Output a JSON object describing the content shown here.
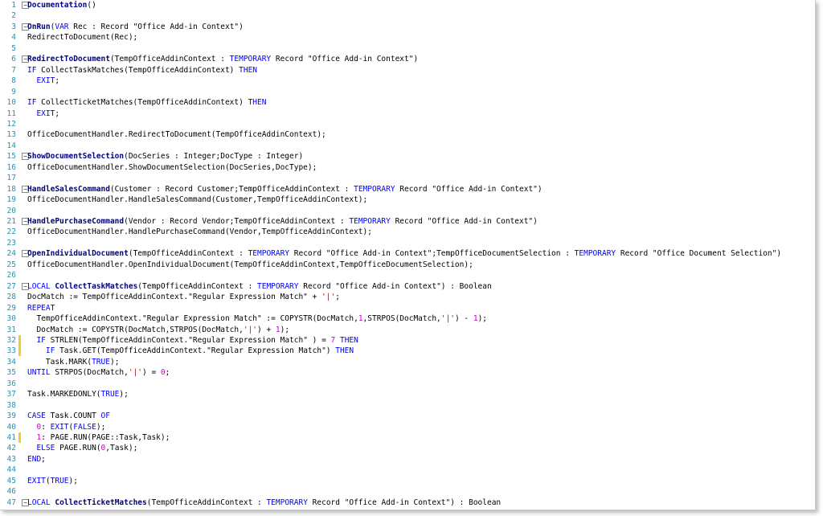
{
  "editor": {
    "lines": [
      {
        "n": "1",
        "fold": true,
        "t": [
          {
            "c": "fn",
            "v": "Documentation"
          },
          {
            "c": "pun",
            "v": "()"
          }
        ]
      },
      {
        "n": "2",
        "t": []
      },
      {
        "n": "3",
        "fold": true,
        "t": [
          {
            "c": "fn",
            "v": "OnRun"
          },
          {
            "c": "pun",
            "v": "("
          },
          {
            "c": "kw",
            "v": "VAR"
          },
          {
            "c": "pun",
            "v": " Rec : Record \"Office Add-in Context\")"
          }
        ]
      },
      {
        "n": "4",
        "t": [
          {
            "c": "pun",
            "v": "RedirectToDocument(Rec);"
          }
        ]
      },
      {
        "n": "5",
        "t": []
      },
      {
        "n": "6",
        "fold": true,
        "t": [
          {
            "c": "fn",
            "v": "RedirectToDocument"
          },
          {
            "c": "pun",
            "v": "(TempOfficeAddinContext : "
          },
          {
            "c": "kw",
            "v": "TEMPORARY"
          },
          {
            "c": "pun",
            "v": " Record \"Office Add-in Context\")"
          }
        ]
      },
      {
        "n": "7",
        "t": [
          {
            "c": "kw",
            "v": "IF"
          },
          {
            "c": "pun",
            "v": " CollectTaskMatches(TempOfficeAddinContext) "
          },
          {
            "c": "kw",
            "v": "THEN"
          }
        ]
      },
      {
        "n": "8",
        "t": [
          {
            "c": "pun",
            "v": "  "
          },
          {
            "c": "kw",
            "v": "EXIT"
          },
          {
            "c": "pun",
            "v": ";"
          }
        ]
      },
      {
        "n": "9",
        "t": []
      },
      {
        "n": "10",
        "t": [
          {
            "c": "kw",
            "v": "IF"
          },
          {
            "c": "pun",
            "v": " CollectTicketMatches(TempOfficeAddinContext) "
          },
          {
            "c": "kw",
            "v": "THEN"
          }
        ]
      },
      {
        "n": "11",
        "t": [
          {
            "c": "pun",
            "v": "  "
          },
          {
            "c": "kw",
            "v": "EXIT"
          },
          {
            "c": "pun",
            "v": ";"
          }
        ]
      },
      {
        "n": "12",
        "t": []
      },
      {
        "n": "13",
        "t": [
          {
            "c": "pun",
            "v": "OfficeDocumentHandler.RedirectToDocument(TempOfficeAddinContext);"
          }
        ]
      },
      {
        "n": "14",
        "t": []
      },
      {
        "n": "15",
        "fold": true,
        "t": [
          {
            "c": "fn",
            "v": "ShowDocumentSelection"
          },
          {
            "c": "pun",
            "v": "(DocSeries : Integer;DocType : Integer)"
          }
        ]
      },
      {
        "n": "16",
        "t": [
          {
            "c": "pun",
            "v": "OfficeDocumentHandler.ShowDocumentSelection(DocSeries,DocType);"
          }
        ]
      },
      {
        "n": "17",
        "t": []
      },
      {
        "n": "18",
        "fold": true,
        "t": [
          {
            "c": "fn",
            "v": "HandleSalesCommand"
          },
          {
            "c": "pun",
            "v": "(Customer : Record Customer;TempOfficeAddinContext : "
          },
          {
            "c": "kw",
            "v": "TEMPORARY"
          },
          {
            "c": "pun",
            "v": " Record \"Office Add-in Context\")"
          }
        ]
      },
      {
        "n": "19",
        "t": [
          {
            "c": "pun",
            "v": "OfficeDocumentHandler.HandleSalesCommand(Customer,TempOfficeAddinContext);"
          }
        ]
      },
      {
        "n": "20",
        "t": []
      },
      {
        "n": "21",
        "fold": true,
        "t": [
          {
            "c": "fn",
            "v": "HandlePurchaseCommand"
          },
          {
            "c": "pun",
            "v": "(Vendor : Record Vendor;TempOfficeAddinContext : "
          },
          {
            "c": "kw",
            "v": "TEMPORARY"
          },
          {
            "c": "pun",
            "v": " Record \"Office Add-in Context\")"
          }
        ]
      },
      {
        "n": "22",
        "t": [
          {
            "c": "pun",
            "v": "OfficeDocumentHandler.HandlePurchaseCommand(Vendor,TempOfficeAddinContext);"
          }
        ]
      },
      {
        "n": "23",
        "t": []
      },
      {
        "n": "24",
        "fold": true,
        "t": [
          {
            "c": "fn",
            "v": "OpenIndividualDocument"
          },
          {
            "c": "pun",
            "v": "(TempOfficeAddinContext : "
          },
          {
            "c": "kw",
            "v": "TEMPORARY"
          },
          {
            "c": "pun",
            "v": " Record \"Office Add-in Context\";TempOfficeDocumentSelection : "
          },
          {
            "c": "kw",
            "v": "TEMPORARY"
          },
          {
            "c": "pun",
            "v": " Record \"Office Document Selection\")"
          }
        ]
      },
      {
        "n": "25",
        "t": [
          {
            "c": "pun",
            "v": "OfficeDocumentHandler.OpenIndividualDocument(TempOfficeAddinContext,TempOfficeDocumentSelection);"
          }
        ]
      },
      {
        "n": "26",
        "t": []
      },
      {
        "n": "27",
        "fold": true,
        "t": [
          {
            "c": "kw",
            "v": "LOCAL"
          },
          {
            "c": "pun",
            "v": " "
          },
          {
            "c": "fn",
            "v": "CollectTaskMatches"
          },
          {
            "c": "pun",
            "v": "(TempOfficeAddinContext : "
          },
          {
            "c": "kw",
            "v": "TEMPORARY"
          },
          {
            "c": "pun",
            "v": " Record \"Office Add-in Context\") : Boolean"
          }
        ]
      },
      {
        "n": "28",
        "t": [
          {
            "c": "pun",
            "v": "DocMatch := TempOfficeAddinContext.\"Regular Expression Match\" + "
          },
          {
            "c": "str",
            "v": "'|'"
          },
          {
            "c": "pun",
            "v": ";"
          }
        ]
      },
      {
        "n": "29",
        "t": [
          {
            "c": "kw",
            "v": "REPEAT"
          }
        ]
      },
      {
        "n": "30",
        "t": [
          {
            "c": "pun",
            "v": "  TempOfficeAddinContext.\"Regular Expression Match\" := COPYSTR(DocMatch,"
          },
          {
            "c": "num",
            "v": "1"
          },
          {
            "c": "pun",
            "v": ",STRPOS(DocMatch,"
          },
          {
            "c": "str",
            "v": "'|'"
          },
          {
            "c": "pun",
            "v": ") - "
          },
          {
            "c": "num",
            "v": "1"
          },
          {
            "c": "pun",
            "v": ");"
          }
        ]
      },
      {
        "n": "31",
        "t": [
          {
            "c": "pun",
            "v": "  DocMatch := COPYSTR(DocMatch,STRPOS(DocMatch,"
          },
          {
            "c": "str",
            "v": "'|'"
          },
          {
            "c": "pun",
            "v": ") + "
          },
          {
            "c": "num",
            "v": "1"
          },
          {
            "c": "pun",
            "v": ");"
          }
        ]
      },
      {
        "n": "32",
        "changed": true,
        "t": [
          {
            "c": "pun",
            "v": "  "
          },
          {
            "c": "kw",
            "v": "IF"
          },
          {
            "c": "pun",
            "v": " STRLEN(TempOfficeAddinContext.\"Regular Expression Match\" ) = "
          },
          {
            "c": "num",
            "v": "7"
          },
          {
            "c": "pun",
            "v": " "
          },
          {
            "c": "kw",
            "v": "THEN"
          }
        ]
      },
      {
        "n": "33",
        "changed": true,
        "t": [
          {
            "c": "pun",
            "v": "    "
          },
          {
            "c": "kw",
            "v": "IF"
          },
          {
            "c": "pun",
            "v": " Task.GET(TempOfficeAddinContext.\"Regular Expression Match\") "
          },
          {
            "c": "kw",
            "v": "THEN"
          }
        ]
      },
      {
        "n": "34",
        "t": [
          {
            "c": "pun",
            "v": "    Task.MARK("
          },
          {
            "c": "kw",
            "v": "TRUE"
          },
          {
            "c": "pun",
            "v": ");"
          }
        ]
      },
      {
        "n": "35",
        "t": [
          {
            "c": "kw",
            "v": "UNTIL"
          },
          {
            "c": "pun",
            "v": " STRPOS(DocMatch,"
          },
          {
            "c": "str",
            "v": "'|'"
          },
          {
            "c": "pun",
            "v": ") = "
          },
          {
            "c": "num",
            "v": "0"
          },
          {
            "c": "pun",
            "v": ";"
          }
        ]
      },
      {
        "n": "36",
        "t": []
      },
      {
        "n": "37",
        "t": [
          {
            "c": "pun",
            "v": "Task.MARKEDONLY("
          },
          {
            "c": "kw",
            "v": "TRUE"
          },
          {
            "c": "pun",
            "v": ");"
          }
        ]
      },
      {
        "n": "38",
        "t": []
      },
      {
        "n": "39",
        "t": [
          {
            "c": "kw",
            "v": "CASE"
          },
          {
            "c": "pun",
            "v": " Task.COUNT "
          },
          {
            "c": "kw",
            "v": "OF"
          }
        ]
      },
      {
        "n": "40",
        "t": [
          {
            "c": "pun",
            "v": "  "
          },
          {
            "c": "num",
            "v": "0"
          },
          {
            "c": "pun",
            "v": ": "
          },
          {
            "c": "kw",
            "v": "EXIT"
          },
          {
            "c": "pun",
            "v": "("
          },
          {
            "c": "kw",
            "v": "FALSE"
          },
          {
            "c": "pun",
            "v": ");"
          }
        ]
      },
      {
        "n": "41",
        "changed": true,
        "t": [
          {
            "c": "pun",
            "v": "  "
          },
          {
            "c": "num",
            "v": "1"
          },
          {
            "c": "pun",
            "v": ": PAGE.RUN(PAGE::Task,Task);"
          }
        ]
      },
      {
        "n": "42",
        "t": [
          {
            "c": "pun",
            "v": "  "
          },
          {
            "c": "kw",
            "v": "ELSE"
          },
          {
            "c": "pun",
            "v": " PAGE.RUN("
          },
          {
            "c": "num",
            "v": "0"
          },
          {
            "c": "pun",
            "v": ",Task);"
          }
        ]
      },
      {
        "n": "43",
        "t": [
          {
            "c": "kw",
            "v": "END"
          },
          {
            "c": "pun",
            "v": ";"
          }
        ]
      },
      {
        "n": "44",
        "t": []
      },
      {
        "n": "45",
        "t": [
          {
            "c": "kw",
            "v": "EXIT"
          },
          {
            "c": "pun",
            "v": "("
          },
          {
            "c": "kw",
            "v": "TRUE"
          },
          {
            "c": "pun",
            "v": ");"
          }
        ]
      },
      {
        "n": "46",
        "t": []
      },
      {
        "n": "47",
        "fold": true,
        "t": [
          {
            "c": "kw",
            "v": "LOCAL"
          },
          {
            "c": "pun",
            "v": " "
          },
          {
            "c": "fn",
            "v": "CollectTicketMatches"
          },
          {
            "c": "pun",
            "v": "(TempOfficeAddinContext : "
          },
          {
            "c": "kw",
            "v": "TEMPORARY"
          },
          {
            "c": "pun",
            "v": " Record \"Office Add-in Context\") : Boolean"
          }
        ]
      }
    ]
  },
  "colors": {
    "keyword": "#0000ff",
    "function": "#000080",
    "string": "#a31515",
    "number": "#c800c8",
    "line_number": "#2b91af",
    "change_marker": "#f2cb2f"
  },
  "icons": {
    "fold": "collapse-minus-icon"
  }
}
